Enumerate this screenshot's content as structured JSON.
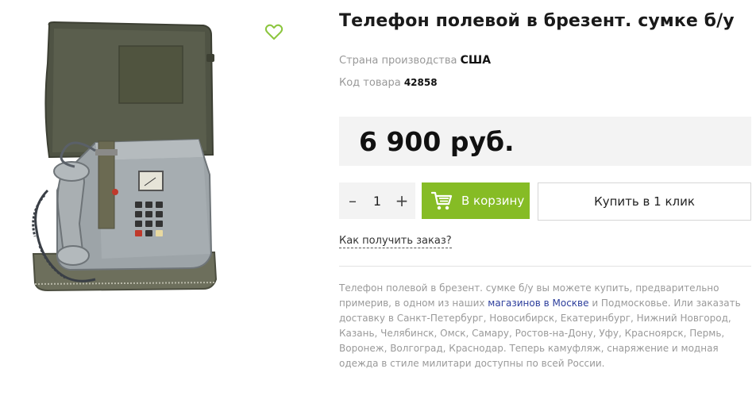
{
  "product": {
    "title": "Телефон полевой в брезент. сумке б/у",
    "country_label": "Страна производства",
    "country_value": "США",
    "code_label": "Код товара",
    "code_value": "42858",
    "price": "6 900 руб.",
    "image_alt": "Телефон полевой в брезент. сумке б/у"
  },
  "purchase": {
    "qty_minus": "–",
    "qty_value": "1",
    "qty_plus": "+",
    "cart_label": "В корзину",
    "one_click_label": "Купить в 1 клик",
    "how_to_get": "Как получить заказ?"
  },
  "description": {
    "text_before": "Телефон полевой в брезент. сумке б/у вы можете купить, предварительно примерив, в одном из наших ",
    "link_text": "магазинов в Москве",
    "text_after": " и Подмосковье. Или заказать доставку в Санкт-Петербург, Новосибирск, Екатеринбург, Нижний Новгород, Казань, Челябинск, Омск, Самару, Ростов-на-Дону, Уфу, Красноярск, Пермь, Воронеж, Волгоград, Краснодар. Теперь камуфляж, снаряжение и модная одежда в стиле милитари доступны по всей России."
  },
  "icons": {
    "favorite": "heart-outline-icon",
    "cart": "shopping-cart-icon"
  },
  "colors": {
    "accent_green": "#86bc25",
    "favorite_green": "#8cc63f",
    "link_blue": "#2c3e9c",
    "price_bg": "#f3f3f3"
  }
}
